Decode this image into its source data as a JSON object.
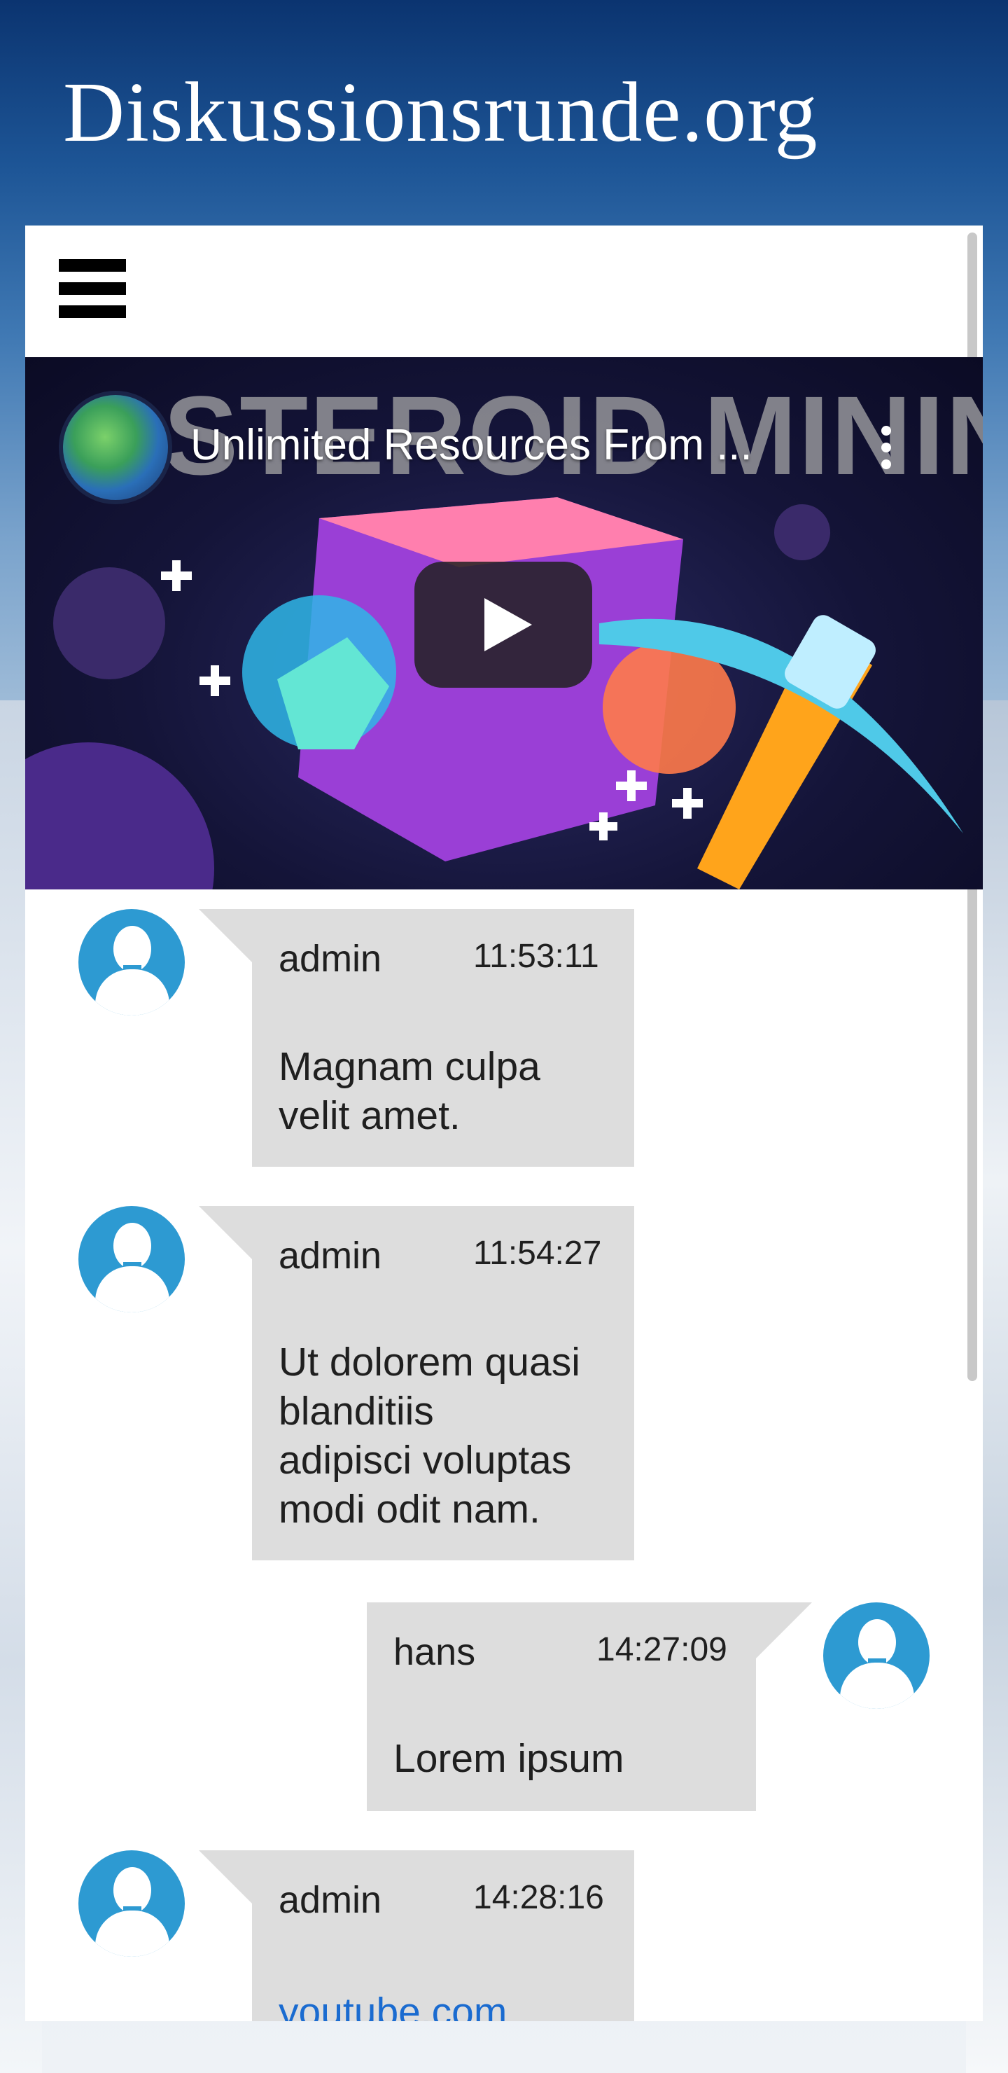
{
  "site": {
    "title": "Diskussionsrunde.org"
  },
  "video": {
    "headline_art": "ASTEROID MINING",
    "title": "Unlimited Resources From ...",
    "menu_icon": "more-vert-icon",
    "play_icon": "play-icon"
  },
  "messages": [
    {
      "author": "admin",
      "time": "11:53:11",
      "lines": [
        "Magnam culpa",
        "velit amet."
      ]
    },
    {
      "author": "admin",
      "time": "11:54:27",
      "lines": [
        "Ut dolorem quasi",
        "blanditiis",
        "adipisci voluptas",
        "modi odit nam."
      ]
    },
    {
      "author": "hans",
      "time": "14:27:09",
      "lines": [
        "Lorem ipsum"
      ]
    },
    {
      "author": "admin",
      "time": "14:28:16",
      "link": "youtube.com"
    }
  ],
  "colors": {
    "avatar": "#2d9ad2",
    "bubble": "#dddddd",
    "link": "#1a6bd0"
  }
}
